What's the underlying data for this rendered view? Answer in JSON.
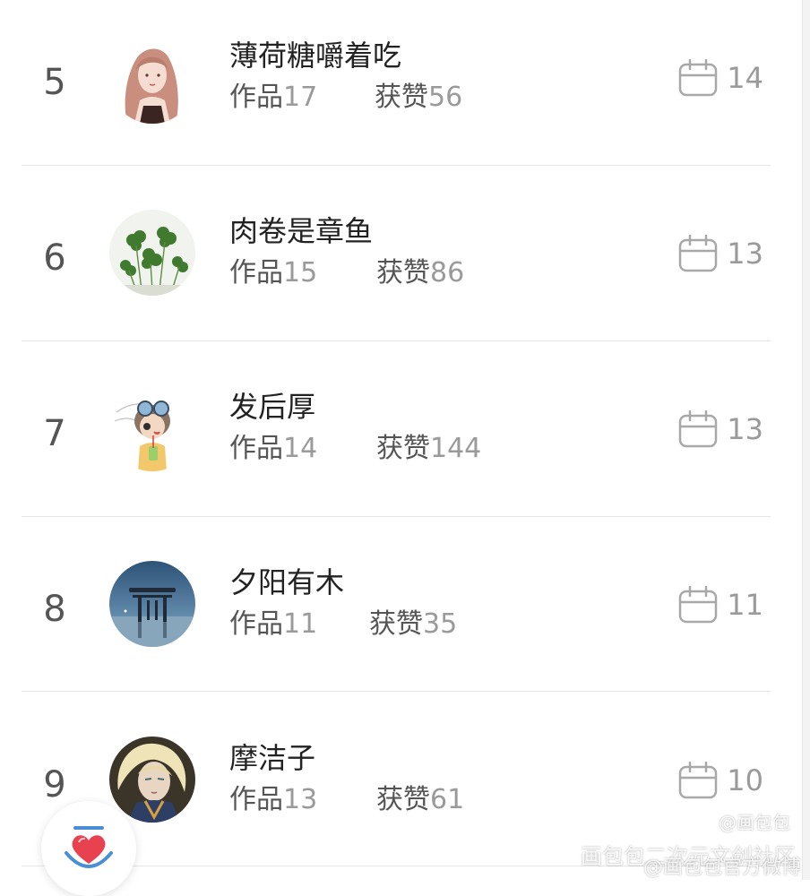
{
  "ranking": {
    "items": [
      {
        "rank": "5",
        "name": "薄荷糖嚼着吃",
        "works_label": "作品",
        "works": "17",
        "likes_label": "获赞",
        "likes": "56",
        "days": "14",
        "avatar": "girl-illustration-avatar"
      },
      {
        "rank": "6",
        "name": "肉卷是章鱼",
        "works_label": "作品",
        "works": "15",
        "likes_label": "获赞",
        "likes": "86",
        "days": "13",
        "avatar": "clover-plant-avatar"
      },
      {
        "rank": "7",
        "name": "发后厚",
        "works_label": "作品",
        "works": "14",
        "likes_label": "获赞",
        "likes": "144",
        "days": "13",
        "avatar": "goggles-character-avatar"
      },
      {
        "rank": "8",
        "name": "夕阳有木",
        "works_label": "作品",
        "works": "11",
        "likes_label": "获赞",
        "likes": "35",
        "days": "11",
        "avatar": "torii-gate-avatar"
      },
      {
        "rank": "9",
        "name": "摩洁子",
        "works_label": "作品",
        "works": "13",
        "likes_label": "获赞",
        "likes": "61",
        "days": "10",
        "avatar": "blonde-character-avatar"
      }
    ],
    "day_icon": "calendar-icon"
  },
  "fab": {
    "icon": "heart-bowl-icon"
  },
  "watermark": {
    "line1": "@画包包",
    "line2": "画包包二次元文创社区",
    "line3": "@画包包官方微博"
  },
  "colors": {
    "accent": "#e8414f",
    "accent_blue": "#4a8fd6"
  }
}
